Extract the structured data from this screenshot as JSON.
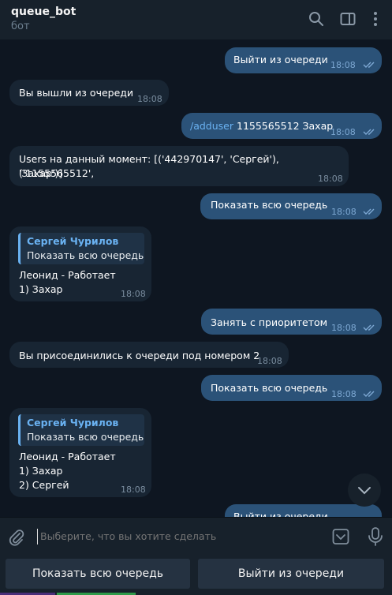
{
  "header": {
    "title": "queue_bot",
    "subtitle": "бот"
  },
  "messages": {
    "m1": {
      "text": "Выйти из очереди",
      "time": "18:08"
    },
    "m2": {
      "text": "Вы вышли из очереди",
      "time": "18:08"
    },
    "m3": {
      "command": "/adduser",
      "text": " 1155565512 Захар",
      "time": "18:08"
    },
    "m4": {
      "line1": "Users на данный момент: [('442970147', 'Сергей'), ('1155565512',",
      "line2": "'Захар')]",
      "time": "18:08"
    },
    "m5": {
      "text": "Показать всю очередь",
      "time": "18:08"
    },
    "m6": {
      "reply_name": "Сергей Чурилов",
      "reply_text": "Показать всю очередь",
      "line1": "Леонид - Работает",
      "line2": "1) Захар",
      "time": "18:08"
    },
    "m7": {
      "text": "Занять с приоритетом",
      "time": "18:08"
    },
    "m8": {
      "text": "Вы присоединились к очереди под номером 2",
      "time": "18:08"
    },
    "m9": {
      "text": "Показать всю очередь",
      "time": "18:08"
    },
    "m10": {
      "reply_name": "Сергей Чурилов",
      "reply_text": "Показать всю очередь",
      "line1": "Леонид - Работает",
      "line2": "1) Захар",
      "line3": "2) Сергей",
      "time": "18:08"
    },
    "m11": {
      "text": "Выйти из очереди"
    }
  },
  "input": {
    "placeholder": "Выберите, что вы хотите сделать"
  },
  "keyboard": {
    "btn1": "Показать всю очередь",
    "btn2": "Выйти из очереди"
  }
}
